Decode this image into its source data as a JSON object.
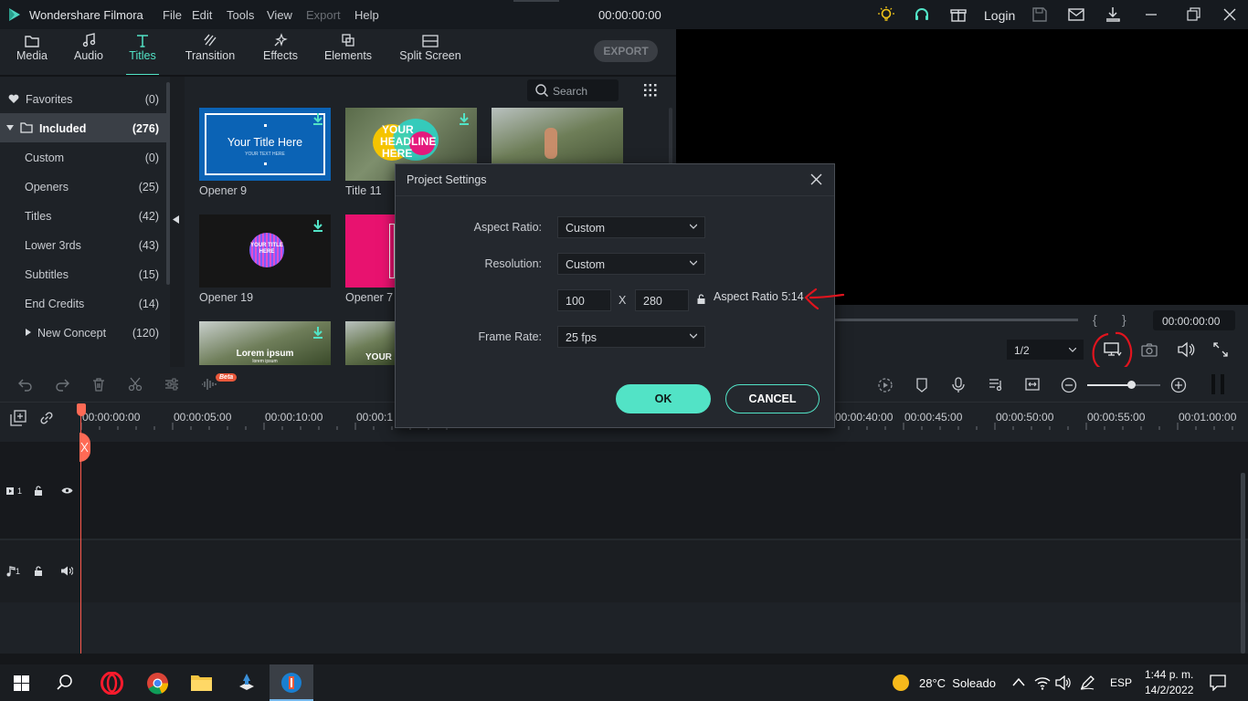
{
  "app": {
    "title": "Wondershare Filmora",
    "timecode": "00:00:00:00",
    "login": "Login"
  },
  "menu": [
    "File",
    "Edit",
    "Tools",
    "View",
    "Export",
    "Help"
  ],
  "tools": [
    {
      "label": "Media",
      "icon": "folder-icon"
    },
    {
      "label": "Audio",
      "icon": "music-note-icon"
    },
    {
      "label": "Titles",
      "icon": "text-t-icon"
    },
    {
      "label": "Transition",
      "icon": "transition-icon"
    },
    {
      "label": "Effects",
      "icon": "effects-icon"
    },
    {
      "label": "Elements",
      "icon": "elements-icon"
    },
    {
      "label": "Split Screen",
      "icon": "split-screen-icon"
    }
  ],
  "export_label": "EXPORT",
  "sidebar": {
    "favorites": {
      "label": "Favorites",
      "count": "(0)"
    },
    "included": {
      "label": "Included",
      "count": "(276)"
    },
    "items": [
      {
        "label": "Custom",
        "count": "(0)"
      },
      {
        "label": "Openers",
        "count": "(25)"
      },
      {
        "label": "Titles",
        "count": "(42)"
      },
      {
        "label": "Lower 3rds",
        "count": "(43)"
      },
      {
        "label": "Subtitles",
        "count": "(15)"
      },
      {
        "label": "End Credits",
        "count": "(14)"
      }
    ],
    "new_concept": {
      "label": "New Concept",
      "count": "(120)"
    }
  },
  "search": {
    "label": "Search"
  },
  "thumbs": {
    "opener9": {
      "label": "Opener 9",
      "title": "Your Title Here",
      "sub": "YOUR TEXT HERE"
    },
    "title11": {
      "label": "Title 11",
      "text1": "YOUR",
      "text2": "HEADLINE",
      "text3": "HERE"
    },
    "opener19": {
      "label": "Opener 19",
      "text": "YOUR TITLE HERE"
    },
    "opener7": {
      "label": "Opener 7"
    },
    "lorem": {
      "text": "Lorem ipsum",
      "sub": "lorem ipsum"
    },
    "your": {
      "text": "YOUR"
    }
  },
  "preview": {
    "timecode": "00:00:00:00",
    "zoom": "1/2",
    "mark_in": "{",
    "mark_out": "}"
  },
  "timeline": {
    "beta": "Beta",
    "ticks": [
      "00:00:00:00",
      "00:00:05:00",
      "00:00:10:00",
      "00:00:1",
      "00:00:40:00",
      "00:00:45:00",
      "00:00:50:00",
      "00:00:55:00",
      "00:01:00:00"
    ],
    "video_track": "1",
    "audio_track": "1"
  },
  "dialog": {
    "title": "Project Settings",
    "aspect_label": "Aspect Ratio:",
    "aspect_value": "Custom",
    "resolution_label": "Resolution:",
    "resolution_value": "Custom",
    "width": "100",
    "x": "X",
    "height": "280",
    "ratio_text": "Aspect Ratio 5:14",
    "framerate_label": "Frame Rate:",
    "framerate_value": "25 fps",
    "ok": "OK",
    "cancel": "CANCEL"
  },
  "taskbar": {
    "weather": "28°C  Soleado",
    "lang": "ESP",
    "time": "1:44 p. m.",
    "date": "14/2/2022"
  },
  "colors": {
    "accent": "#52e3c6",
    "annotation": "#e0141e",
    "bg": "#1e2227"
  }
}
